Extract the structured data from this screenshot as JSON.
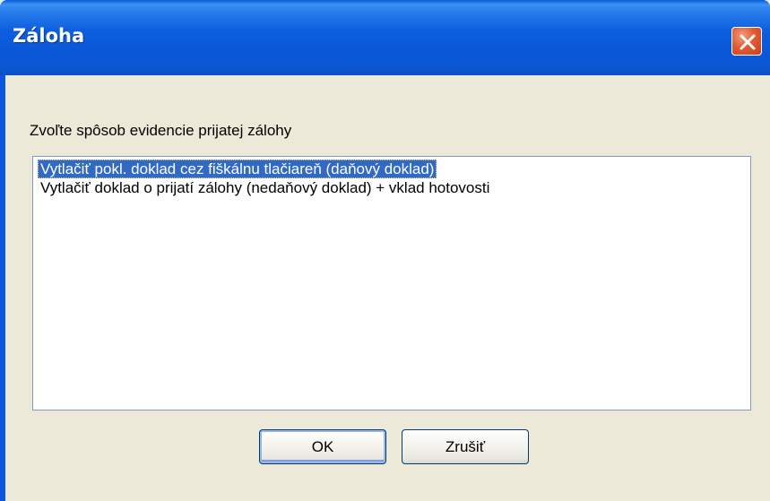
{
  "window": {
    "title": "Záloha"
  },
  "prompt": "Zvoľte spôsob evidencie prijatej zálohy",
  "list": {
    "items": [
      {
        "label": "Vytlačiť pokl. doklad cez fiškálnu tlačiareň (daňový doklad)",
        "selected": true
      },
      {
        "label": "Vytlačiť doklad o prijatí zálohy (nedaňový doklad) + vklad hotovosti",
        "selected": false
      }
    ]
  },
  "buttons": {
    "ok_label": "OK",
    "cancel_label": "Zrušiť"
  },
  "icons": {
    "close": "close-icon"
  },
  "colors": {
    "titlebar": "#0a58d8",
    "selection": "#316ac5",
    "close_button": "#e25b33",
    "dialog_background": "#ece9d8"
  }
}
